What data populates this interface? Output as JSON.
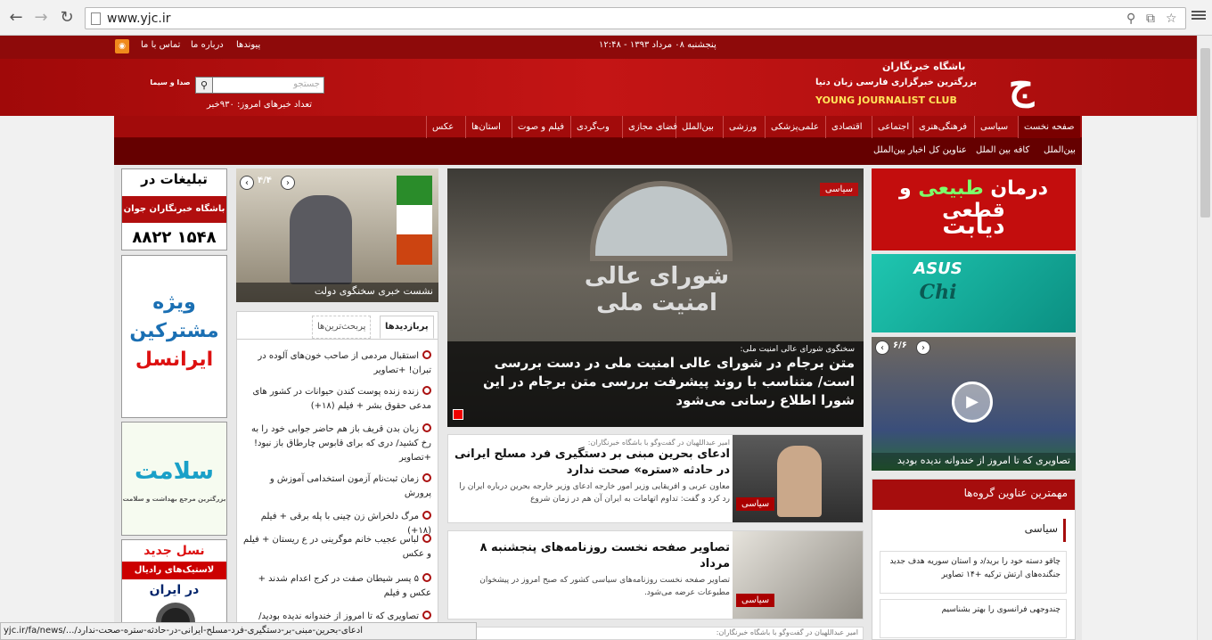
{
  "browser": {
    "url": "www.yjc.ir",
    "status_url": "yjc.ir/fa/news/.../ادعای-بحرین-مبنی-بر-دستگیری-فرد-مسلح-ایرانی-در-حادثه-ستره-صحت-ندارد"
  },
  "topbar": {
    "links": [
      "پیوندها",
      "درباره ما",
      "تماس با ما"
    ],
    "datetime": "۱۲:۴۸ - پنجشنبه ۰۸ مرداد ۱۳۹۳"
  },
  "header": {
    "brand1": "باشگاه خبرنگاران",
    "brand2": "بزرگترین خبرگزاری فارسی زبان دنیا",
    "brand3": "YOUNG JOURNALIST CLUB",
    "logo_glyph": "ج",
    "search_placeholder": "جستجو",
    "news_count": "تعداد خبرهای امروز: ۹۳۰خبر",
    "irib": "صدا و سیما"
  },
  "nav": {
    "items": [
      "صفحه نخست",
      "سیاسی",
      "فرهنگی‌هنری",
      "اجتماعی",
      "اقتصادی",
      "علمی‌پزشکی",
      "ورزشی",
      "بین‌الملل",
      "فضای مجازی",
      "وب‌گردی",
      "فیلم و صوت",
      "استان‌ها",
      "عکس"
    ]
  },
  "subnav": {
    "items": [
      "بین‌الملل",
      "کافه بین الملل",
      "عناوین کل اخبار بین‌الملل"
    ]
  },
  "ads": {
    "left_top": {
      "line1": "تبلیغات در",
      "line2": "باشگاه خبرنگاران جوان",
      "phone": "۸۸۲۲ ۱۵۴۸"
    },
    "irancell": {
      "l1": "ویژه",
      "l2": "مشترکین",
      "l3": "ایرانسل"
    },
    "salamat": {
      "title": "سلامت",
      "sub": "بزرگترین مرجع بهداشت و سلامت"
    },
    "tires": {
      "l1": "نسل جدید",
      "l2": "لاستیک‌های رادیال",
      "l3": "در ایران"
    },
    "diabetes": {
      "l1": "درمان",
      "l2": "طبیعی",
      "l3": "و",
      "l4": "قطعی",
      "l5": "دیابت"
    },
    "asus": {
      "brand": "ASUS",
      "sub": "Chi"
    }
  },
  "small_slider": {
    "counter": "۴/۴",
    "caption": "نشست خبری سخنگوی دولت"
  },
  "tabs": {
    "t1": "پربازدیدها",
    "t2": "پربحث‌ترین‌ها"
  },
  "most_viewed": [
    "استقبال مردمی از صاحب خون‌های آلوده در تبران! +تصاویر",
    "زنده زنده پوست کندن حیوانات در کشور های مدعی حقوق بشر + فیلم (۱۸+)",
    "زبان بدن قریف باز هم حاضر جوابی خود را به رخ کشید/ دری که برای قابوس چارطاق باز نبود! +تصاویر",
    "زمان ثبت‌نام آزمون استخدامی آموزش و پرورش",
    "مرگ دلخراش زن چینی با پله برقی + فیلم (۱۸+)",
    "لباس عجیب خانم موگرینی در ع ریستان + فیلم و عکس",
    "۵ پسر شیطان صفت در کرج اعدام شدند + عکس و فیلم",
    "تصاویری که تا امروز از خندوانه ندیده بودید/"
  ],
  "hero": {
    "tag": "سیاسی",
    "kicker": "سخنگوی شورای عالی امنیت ملی:",
    "headline": "متن برجام در شورای عالی امنیت ملی در دست بررسی است/ متناسب با روند پیشرفت بررسی متن برجام در این شورا اطلاع رسانی می‌شود",
    "sign": "شورای عالی امنیت ملی"
  },
  "cards": [
    {
      "kicker": "امیر عبداللهیان در گفت‌وگو با باشگاه خبرنگاران:",
      "title": "ادعای بحرین مبنی بر دستگیری فرد مسلح ایرانی در حادثه «ستره» صحت ندارد",
      "body": "معاون عربی و افریقایی وزیر امور خارجه ادعای وزیر خارجه بحرین درباره ایران را رد کرد و گفت: تداوم اتهامات به ایران آن هم در زمان شروع",
      "tag": "سیاسی"
    },
    {
      "kicker": "",
      "title": "تصاویر صفحه نخست روزنامه‌های پنجشنبه ۸ مرداد",
      "body": "تصاویر صفحه نخست روزنامه‌های سیاسی کشور که صبح امروز در پیشخوان مطبوعات عرضه می‌شود.",
      "tag": "سیاسی"
    }
  ],
  "bottom_peek": "امیر عبداللهیان در گفت‌وگو با باشگاه خبرنگاران:",
  "video_slider": {
    "counter": "۶/۶",
    "caption": "تصاویری که تا امروز از خندوانه ندیده بودید"
  },
  "top_groups": {
    "title": "مهمترین عناوین گروه‌ها",
    "section": "سیاسی",
    "items": [
      "چاقو دسته خود را برید/د و استان سوریه هدف جدید جنگنده‌های ارتش ترکیه +۱۴ تصاویر",
      "چندوجهی فرانسوی را بهتر بشناسیم"
    ]
  },
  "colors": {
    "brand_red": "#a20b0b",
    "dark_red": "#650000"
  }
}
